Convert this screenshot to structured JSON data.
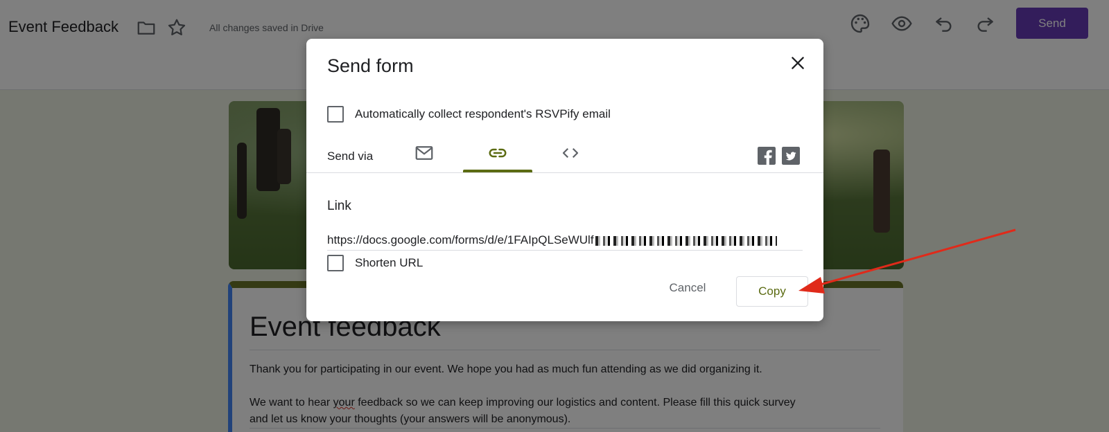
{
  "app": {
    "doc_title": "Event Feedback",
    "save_status": "All changes saved in Drive",
    "send_label": "Send",
    "accent_color": "#673ab7",
    "icons": [
      "folder-icon",
      "star-icon",
      "palette-icon",
      "eye-icon",
      "undo-icon",
      "redo-icon"
    ]
  },
  "form": {
    "title": "Event feedback",
    "description_1": "Thank you for participating in our event. We hope you had as much fun attending as we did organizing it.",
    "description_2a": "We want to hear ",
    "description_2b": "your",
    "description_2c": " feedback so we can keep improving our logistics and content. Please fill this quick survey",
    "description_3": "and let us know your thoughts (your answers will be anonymous).",
    "theme_color": "#6b7428"
  },
  "dialog": {
    "title": "Send form",
    "collect_email_label": "Automatically collect respondent's RSVPify email",
    "send_via_label": "Send via",
    "tabs": [
      {
        "icon": "email-icon",
        "active": false
      },
      {
        "icon": "link-icon",
        "active": true
      },
      {
        "icon": "embed-code-icon",
        "active": false
      }
    ],
    "social": [
      "facebook-icon",
      "twitter-icon"
    ],
    "link_heading": "Link",
    "link_url": "https://docs.google.com/forms/d/e/1FAIpQLSeWUlf",
    "shorten_url_label": "Shorten URL",
    "cancel_label": "Cancel",
    "copy_label": "Copy",
    "accent_color": "#5b6b12"
  },
  "annotation": {
    "arrow_color": "#e02a1a",
    "points_to": "copy-button"
  }
}
